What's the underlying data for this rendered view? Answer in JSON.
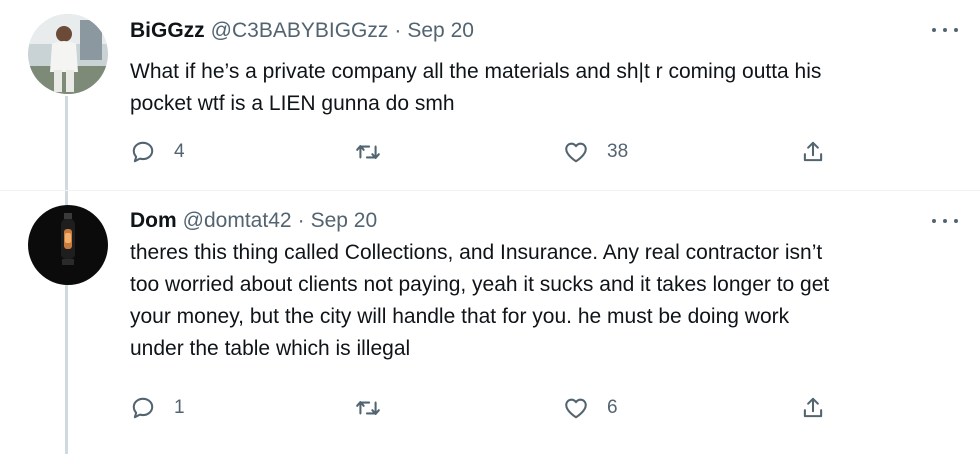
{
  "tweets": [
    {
      "display_name": "BiGGzz",
      "handle": "@C3BABYBIGGzz",
      "separator": "·",
      "date": "Sep 20",
      "text_lines": [
        "What if he’s a private company all the materials and sh|t r coming outta his",
        "pocket wtf is a LIEN gunna do smh"
      ],
      "replies": "4",
      "retweets": "",
      "likes": "38",
      "avatar_icon": "person-photo-avatar"
    },
    {
      "display_name": "Dom",
      "handle": "@domtat42",
      "separator": "·",
      "date": "Sep 20",
      "text_lines": [
        "theres this thing called Collections, and Insurance. Any real contractor isn’t",
        "too worried about clients not paying, yeah it sucks and it takes longer to get",
        "your money, but the city will handle that for you. he must be doing work",
        "under the table which is illegal"
      ],
      "replies": "1",
      "retweets": "",
      "likes": "6",
      "avatar_icon": "dark-lantern-avatar"
    }
  ],
  "icons": {
    "reply": "reply-icon",
    "retweet": "retweet-icon",
    "like": "heart-icon",
    "share": "share-icon",
    "more": "more-icon"
  },
  "colors": {
    "text": "#0f1419",
    "secondary": "#536471",
    "thread_line": "#cfd9de"
  }
}
